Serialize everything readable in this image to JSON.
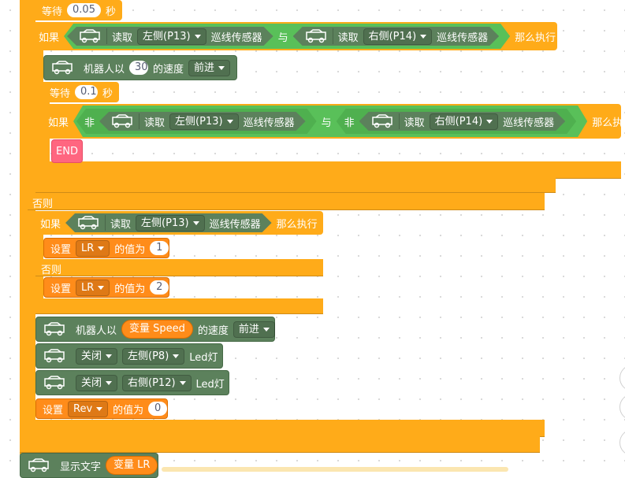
{
  "labels": {
    "wait": "等待",
    "sec": "秒",
    "if": "如果",
    "then": "那么执行",
    "else": "否则",
    "read": "读取",
    "line_sensor": "巡线传感器",
    "and": "与",
    "not": "非",
    "robot_speed": "机器人以",
    "speed_of": "的速度",
    "set": "设置",
    "value_of": "的值为",
    "end": "END",
    "led": "Led灯",
    "show_text": "显示文字"
  },
  "dropdowns": {
    "left_p13": "左侧(P13)",
    "right_p14": "右侧(P14)",
    "forward": "前进",
    "var_lr": "LR",
    "var_rev": "Rev",
    "off": "关闭",
    "left_p8": "左侧(P8)",
    "right_p12": "右侧(P12)"
  },
  "values": {
    "wait1": "0.05",
    "wait2": "0.1",
    "speed1": "30",
    "lr1": "1",
    "lr2": "2",
    "rev": "0"
  },
  "reporters": {
    "var_speed": "变量 Speed",
    "var_lr": "变量 LR"
  },
  "colors": {
    "control": "#ffab19",
    "operator": "#59c059",
    "robot": "#5c815c",
    "data": "#ff8c1a",
    "end": "#ff6680"
  },
  "icons": {
    "robot_car": "robot-car-icon",
    "dropdown": "chevron-down-icon"
  }
}
